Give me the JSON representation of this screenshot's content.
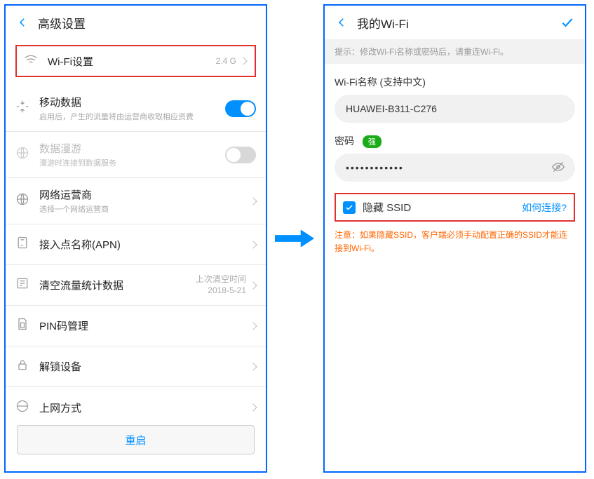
{
  "left": {
    "title": "高级设置",
    "wifi_settings": {
      "label": "Wi-Fi设置",
      "value": "2.4 G"
    },
    "mobile_data": {
      "label": "移动数据",
      "sub": "启用后，产生的流量将由运营商收取相应资费",
      "on": true
    },
    "roaming": {
      "label": "数据漫游",
      "sub": "漫游时连接到数据服务",
      "on": false
    },
    "carrier": {
      "label": "网络运营商",
      "sub": "选择一个网络运营商"
    },
    "apn": {
      "label": "接入点名称(APN)"
    },
    "clear_stats": {
      "label": "清空流量统计数据",
      "time_label": "上次清空时间",
      "time_value": "2018-5-21"
    },
    "pin": {
      "label": "PIN码管理"
    },
    "unlock": {
      "label": "解锁设备"
    },
    "net_mode": {
      "label": "上网方式"
    },
    "restart_button": "重启"
  },
  "right": {
    "title": "我的Wi-Fi",
    "hint": "提示：修改Wi-Fi名称或密码后，请重连Wi-Fi。",
    "name_label": "Wi-Fi名称 (支持中文)",
    "name_value": "HUAWEI-B311-C276",
    "password_label": "密码",
    "password_strength": "强",
    "password_masked": "••••••••••••",
    "hide_ssid_label": "隐藏 SSID",
    "how_connect": "如何连接?",
    "warning_text": "注意：如果隐藏SSID，客户端必须手动配置正确的SSID才能连接到Wi-Fi。"
  }
}
